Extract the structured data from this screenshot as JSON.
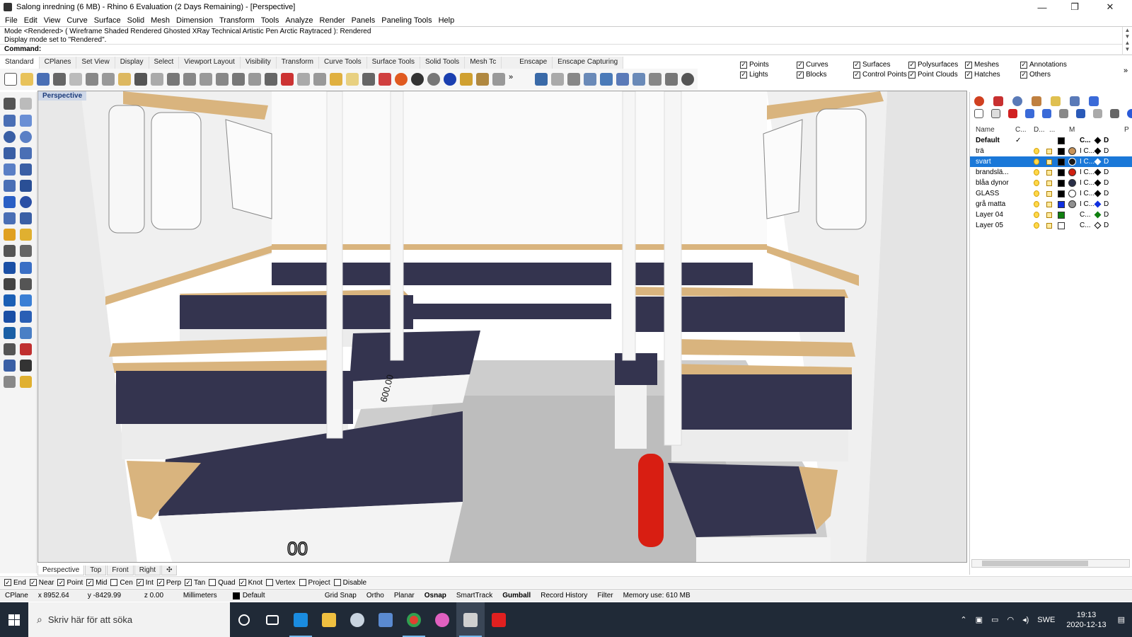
{
  "window": {
    "title": "Salong inredning (6 MB) - Rhino 6 Evaluation (2 Days Remaining) - [Perspective]",
    "minimize": "—",
    "maximize": "❐",
    "close": "✕"
  },
  "menu": [
    "File",
    "Edit",
    "View",
    "Curve",
    "Surface",
    "Solid",
    "Mesh",
    "Dimension",
    "Transform",
    "Tools",
    "Analyze",
    "Render",
    "Panels",
    "Paneling Tools",
    "Help"
  ],
  "command": {
    "history1": "Mode <Rendered> ( Wireframe  Shaded  Rendered  Ghosted  XRay  Technical  Artistic  Pen  Arctic  Raytraced ): Rendered",
    "history2": "Display mode set to \"Rendered\".",
    "prompt": "Command:"
  },
  "toolbar_tabs": [
    "Standard",
    "CPlanes",
    "Set View",
    "Display",
    "Select",
    "Viewport Layout",
    "Visibility",
    "Transform",
    "Curve Tools",
    "Surface Tools",
    "Solid Tools",
    "Mesh Tc"
  ],
  "toolbar_tabs2": [
    "Enscape",
    "Enscape Capturing"
  ],
  "selection_filter": {
    "items": [
      {
        "label": "Points",
        "checked": "✓"
      },
      {
        "label": "Lights",
        "checked": "✓"
      },
      {
        "label": "Curves",
        "checked": "✓"
      },
      {
        "label": "Blocks",
        "checked": "✓"
      },
      {
        "label": "Surfaces",
        "checked": "✓"
      },
      {
        "label": "Control Points",
        "checked": "✓"
      },
      {
        "label": "Polysurfaces",
        "checked": "✓"
      },
      {
        "label": "Point Clouds",
        "checked": "✓"
      },
      {
        "label": "Meshes",
        "checked": "✓"
      },
      {
        "label": "Hatches",
        "checked": "✓"
      },
      {
        "label": "Annotations",
        "checked": "✓"
      },
      {
        "label": "Others",
        "checked": "✓"
      }
    ]
  },
  "viewport": {
    "label": "Perspective",
    "tabs": [
      "Perspective",
      "Top",
      "Front",
      "Right"
    ],
    "add_tab": "✣",
    "dim1": "600.00",
    "dim2": "00"
  },
  "layers": {
    "headers": [
      "Name",
      "C...",
      "D...",
      "...",
      "M",
      "",
      "P"
    ],
    "rows": [
      {
        "name": "Default",
        "current": "✓",
        "color": "#000000",
        "material": "",
        "mat_color": "",
        "x": "C...",
        "d": "D",
        "sel": false
      },
      {
        "name": "trä",
        "current": "",
        "color": "#000000",
        "material": "#c8945a",
        "mat_color": "#c8945a",
        "x": "I C...",
        "d": "D",
        "sel": false
      },
      {
        "name": "svart",
        "current": "",
        "color": "#000000",
        "material": "#1a1a1a",
        "mat_color": "#1a1a1a",
        "x": "I C...",
        "d": "D",
        "sel": true
      },
      {
        "name": "brandslä...",
        "current": "",
        "color": "#000000",
        "material": "#d02010",
        "mat_color": "#d02010",
        "x": "I C...",
        "d": "D",
        "sel": false
      },
      {
        "name": "blåa dynor",
        "current": "",
        "color": "#000000",
        "material": "#2a2f48",
        "mat_color": "#2a2f48",
        "x": "I C...",
        "d": "D",
        "sel": false
      },
      {
        "name": "GLASS",
        "current": "",
        "color": "#000000",
        "material": "#ffffff",
        "mat_color": "#ffffff",
        "x": "I C...",
        "d": "D",
        "sel": false
      },
      {
        "name": "grå matta",
        "current": "",
        "color": "#1030e0",
        "material": "#909090",
        "mat_color": "#909090",
        "x": "I C...",
        "d": "D",
        "sel": false
      },
      {
        "name": "Layer 04",
        "current": "",
        "color": "#108010",
        "material": "",
        "mat_color": "",
        "x": "C...",
        "d": "D",
        "sel": false
      },
      {
        "name": "Layer 05",
        "current": "",
        "color": "#ffffff",
        "material": "",
        "mat_color": "",
        "x": "C...",
        "d": "D",
        "sel": false
      }
    ]
  },
  "osnap": [
    {
      "label": "End",
      "checked": "✓"
    },
    {
      "label": "Near",
      "checked": "✓"
    },
    {
      "label": "Point",
      "checked": "✓"
    },
    {
      "label": "Mid",
      "checked": "✓"
    },
    {
      "label": "Cen",
      "checked": ""
    },
    {
      "label": "Int",
      "checked": "✓"
    },
    {
      "label": "Perp",
      "checked": "✓"
    },
    {
      "label": "Tan",
      "checked": "✓"
    },
    {
      "label": "Quad",
      "checked": ""
    },
    {
      "label": "Knot",
      "checked": "✓"
    },
    {
      "label": "Vertex",
      "checked": ""
    },
    {
      "label": "Project",
      "checked": ""
    },
    {
      "label": "Disable",
      "checked": ""
    }
  ],
  "status": {
    "cplane": "CPlane",
    "x": "x 8952.64",
    "y": "y -8429.99",
    "z": "z 0.00",
    "units": "Millimeters",
    "layer": "Default",
    "grid_snap": "Grid Snap",
    "ortho": "Ortho",
    "planar": "Planar",
    "osnap": "Osnap",
    "smarttrack": "SmartTrack",
    "gumball": "Gumball",
    "record": "Record History",
    "filter": "Filter",
    "memory": "Memory use: 610 MB"
  },
  "taskbar": {
    "search_placeholder": "Skriv här för att söka",
    "lang": "SWE",
    "time": "19:13",
    "date": "2020-12-13"
  },
  "colors": {
    "cushion": "#34344f",
    "wood": "#d9b47e",
    "extinguisher": "#d81e12",
    "selection": "#1a78d8"
  }
}
